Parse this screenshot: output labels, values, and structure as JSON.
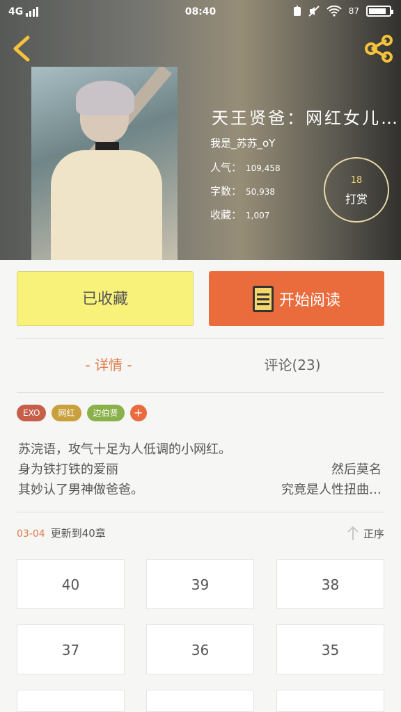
{
  "status_bar": {
    "network": "4G",
    "time": "08:40",
    "battery_pct": "87"
  },
  "book": {
    "title": "天王贤爸：网红女儿…",
    "author": "我是_苏苏_oY",
    "popularity_label": "人气：",
    "popularity": "109,458",
    "word_count_label": "字数：",
    "word_count": "50,938",
    "favorites_label": "收藏：",
    "favorites": "1,007"
  },
  "tip": {
    "count": "18",
    "label": "打赏"
  },
  "actions": {
    "collected_label": "已收藏",
    "read_label": "开始阅读"
  },
  "tabs": {
    "detail": "- 详情 -",
    "comments": "评论(23)"
  },
  "tags": [
    {
      "label": "EXO",
      "color": "#c65f4a"
    },
    {
      "label": "网红",
      "color": "#c9a03c"
    },
    {
      "label": "边伯贤",
      "color": "#8ab04a"
    }
  ],
  "tag_add": "+",
  "description": {
    "line1": "苏浣语，攻气十足为人低调的小网红。",
    "line2_left": "身为铁打铁的爱丽",
    "line2_right": "然后莫名",
    "line3_left": "其妙认了男神做爸爸。",
    "line3_right": "究竟是人性扭曲…"
  },
  "update": {
    "date": "03-04",
    "text": "更新到40章",
    "sort_label": "正序"
  },
  "chapters": [
    "40",
    "39",
    "38",
    "37",
    "36",
    "35"
  ],
  "icons": {
    "back": "chevron-left-icon",
    "share": "share-icon",
    "book": "book-icon",
    "sort": "arrow-up-icon"
  },
  "colors": {
    "accent": "#ea6b3c",
    "collected": "#f9f27a",
    "orange_text": "#e07a48"
  }
}
